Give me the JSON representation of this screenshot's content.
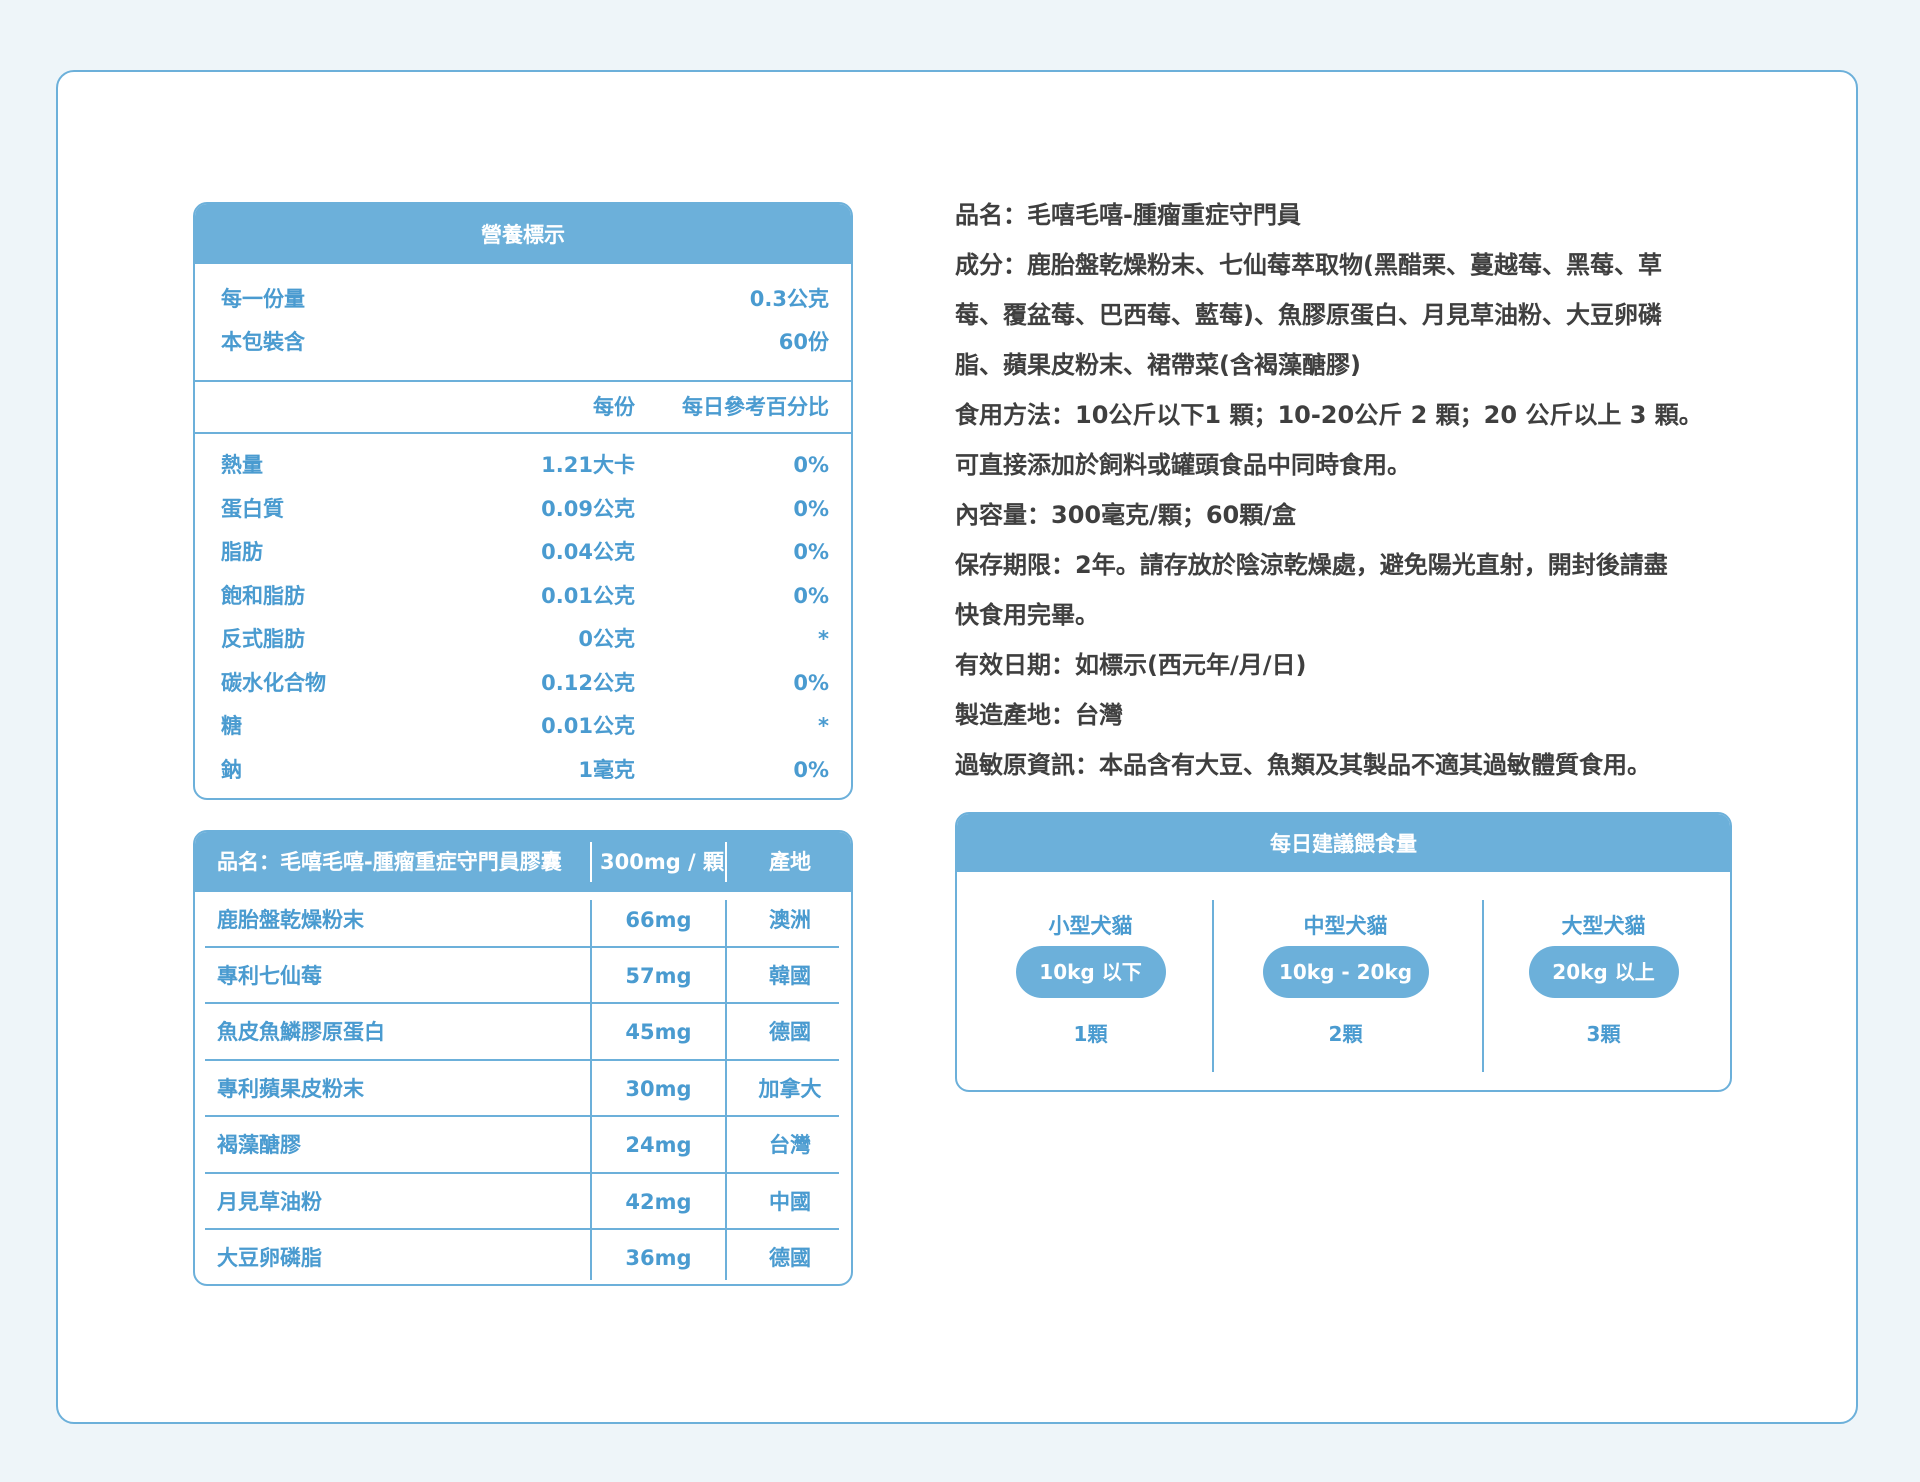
{
  "nutrition": {
    "title": "營養標示",
    "serving_label": "每一份量",
    "serving_value": "0.3公克",
    "pack_label": "本包裝含",
    "pack_value": "60份",
    "col_per": "每份",
    "col_daily": "每日參考百分比",
    "rows": [
      {
        "name": "熱量",
        "per": "1.21大卡",
        "pct": "0%"
      },
      {
        "name": "蛋白質",
        "per": "0.09公克",
        "pct": "0%"
      },
      {
        "name": "脂肪",
        "per": "0.04公克",
        "pct": "0%"
      },
      {
        "name": "飽和脂肪",
        "per": "0.01公克",
        "pct": "0%"
      },
      {
        "name": "反式脂肪",
        "per": "0公克",
        "pct": "*"
      },
      {
        "name": "碳水化合物",
        "per": "0.12公克",
        "pct": "0%"
      },
      {
        "name": "糖",
        "per": "0.01公克",
        "pct": "*"
      },
      {
        "name": "鈉",
        "per": "1毫克",
        "pct": "0%"
      }
    ]
  },
  "ingredients": {
    "header_name": "品名：毛嘻毛嘻-腫瘤重症守門員膠囊",
    "header_amount": "300mg / 顆",
    "header_origin": "產地",
    "rows": [
      {
        "name": "鹿胎盤乾燥粉末",
        "amount": "66mg",
        "origin": "澳洲"
      },
      {
        "name": "專利七仙莓",
        "amount": "57mg",
        "origin": "韓國"
      },
      {
        "name": "魚皮魚鱗膠原蛋白",
        "amount": "45mg",
        "origin": "德國"
      },
      {
        "name": "專利蘋果皮粉末",
        "amount": "30mg",
        "origin": "加拿大"
      },
      {
        "name": "褐藻醣膠",
        "amount": "24mg",
        "origin": "台灣"
      },
      {
        "name": "月見草油粉",
        "amount": "42mg",
        "origin": "中國"
      },
      {
        "name": "大豆卵磷脂",
        "amount": "36mg",
        "origin": "德國"
      }
    ]
  },
  "product_info": {
    "lines": [
      "品名：毛嘻毛嘻-腫瘤重症守門員",
      "成分：鹿胎盤乾燥粉末、七仙莓萃取物(黑醋栗、蔓越莓、黑莓、草",
      "莓、覆盆莓、巴西莓、藍莓)、魚膠原蛋白、月見草油粉、大豆卵磷",
      "脂、蘋果皮粉末、裙帶菜(含褐藻醣膠)",
      "食用方法：10公斤以下1 顆；10-20公斤 2 顆；20 公斤以上 3 顆。",
      "可直接添加於飼料或罐頭食品中同時食用。",
      "內容量：300毫克/顆；60顆/盒",
      "保存期限：2年。請存放於陰涼乾燥處，避免陽光直射，開封後請盡",
      "快食用完畢。",
      "有效日期：如標示(西元年/月/日)",
      "製造產地：台灣",
      "過敏原資訊：本品含有大豆、魚類及其製品不適其過敏體質食用。"
    ]
  },
  "feeding": {
    "title": "每日建議餵食量",
    "columns": [
      {
        "size": "小型犬貓",
        "weight": "10kg 以下",
        "dose": "1顆"
      },
      {
        "size": "中型犬貓",
        "weight": "10kg - 20kg",
        "dose": "2顆"
      },
      {
        "size": "大型犬貓",
        "weight": "20kg 以上",
        "dose": "3顆"
      }
    ]
  },
  "colors": {
    "accent": "#6cb0da",
    "label_text": "#4a9bd0",
    "body_text": "#3f3f3f",
    "background": "#eef5f9"
  }
}
